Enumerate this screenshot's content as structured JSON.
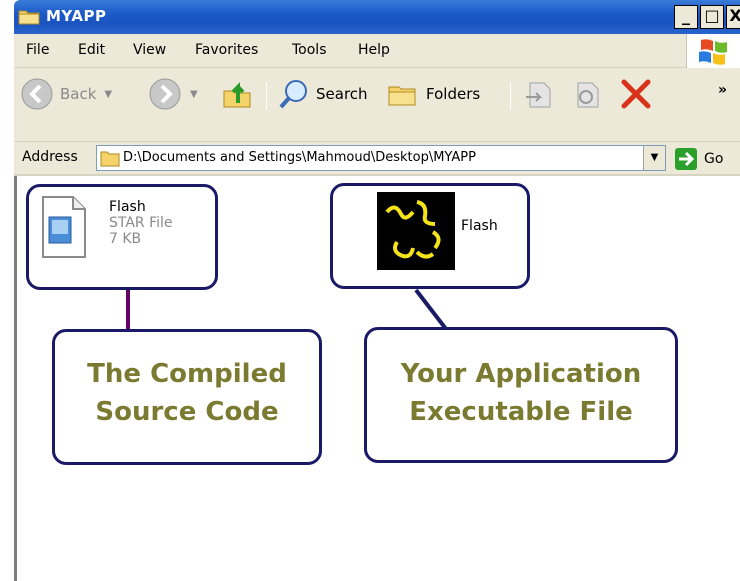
{
  "window": {
    "title": "MYAPP"
  },
  "menu": [
    "File",
    "Edit",
    "View",
    "Favorites",
    "Tools",
    "Help"
  ],
  "toolbar": {
    "back_label": "Back",
    "search_label": "Search",
    "folders_label": "Folders",
    "overflow": "»"
  },
  "address": {
    "label": "Address",
    "path": "D:\\Documents and Settings\\Mahmoud\\Desktop\\MYAPP",
    "go_label": "Go"
  },
  "files": [
    {
      "name": "Flash",
      "type": "STAR File",
      "size": "7 KB",
      "icon": "document-icon"
    },
    {
      "name": "Flash",
      "icon": "flash-executable-icon"
    }
  ],
  "annotations": {
    "compiled_line1": "The Compiled",
    "compiled_line2": "Source Code",
    "executable_line1": "Your Application",
    "executable_line2": "Executable File"
  },
  "colors": {
    "titlebar": "#1c5ac8",
    "chrome": "#ece9d8",
    "callout_border": "#1a1a66",
    "callout_text": "#7a7a30",
    "connector_left": "#660066",
    "connector_right": "#1a1a66"
  }
}
